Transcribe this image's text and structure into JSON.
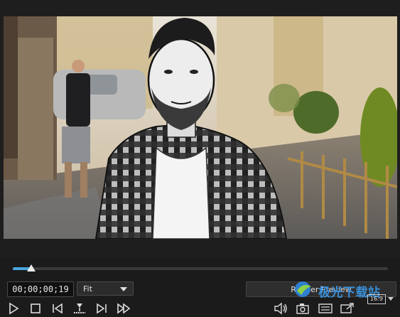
{
  "player": {
    "timecode": "00;00;00;19",
    "fit_label": "Fit",
    "render_preview_label": "Render Preview",
    "aspect_ratio": "16:9",
    "progress": 0.05
  },
  "watermark": {
    "text": "极光下载站"
  },
  "controls": {
    "play": "play-icon",
    "stop": "stop-icon",
    "prev_frame": "previous-frame-icon",
    "split": "split-clip-icon",
    "next_frame": "next-frame-icon",
    "fast_forward": "fast-forward-icon",
    "volume": "volume-icon",
    "snapshot": "camera-snapshot-icon",
    "display_quality": "display-quality-icon",
    "fullscreen": "undock-preview-icon"
  },
  "colors": {
    "accent": "#4aa7e0",
    "background": "#1b1b1b"
  }
}
